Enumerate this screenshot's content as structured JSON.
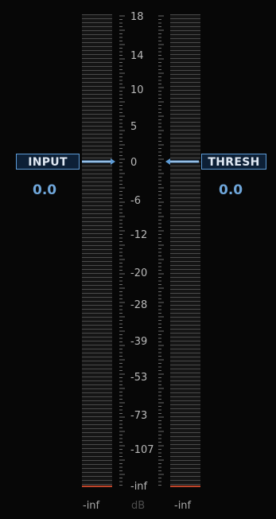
{
  "input": {
    "label": "INPUT",
    "value": "0.0",
    "fader_db": 0
  },
  "thresh": {
    "label": "THRESH",
    "value": "0.0",
    "fader_db": 0
  },
  "meters": {
    "left_readout": "-inf",
    "right_readout": "-inf",
    "unit": "dB"
  },
  "scale": {
    "labels": [
      "18",
      "14",
      "10",
      "5",
      "0",
      "-6",
      "-12",
      "-20",
      "-28",
      "-39",
      "-53",
      "-73",
      "-107",
      "-inf"
    ]
  },
  "colors": {
    "background": "#070707",
    "accent": "#5d9bd6",
    "value_text": "#6fa6da",
    "meter_floor": "#c0452a",
    "scale_text": "#b8b8b8"
  }
}
